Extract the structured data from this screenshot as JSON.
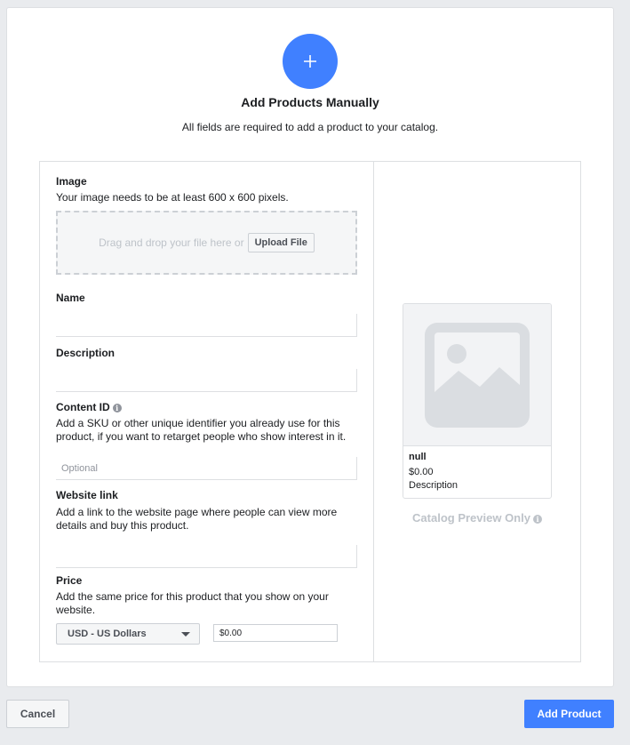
{
  "header": {
    "title": "Add Products Manually",
    "subtitle": "All fields are required to add a product to your catalog.",
    "icon": "plus-icon",
    "accent_color": "#4080ff"
  },
  "form": {
    "image": {
      "label": "Image",
      "help": "Your image needs to be at least 600 x 600 pixels.",
      "dropzone_text": "Drag and drop your file here or",
      "upload_button": "Upload File"
    },
    "name": {
      "label": "Name",
      "value": "",
      "placeholder": ""
    },
    "description": {
      "label": "Description",
      "value": "",
      "placeholder": ""
    },
    "content_id": {
      "label": "Content ID",
      "help": "Add a SKU or other unique identifier you already use for this product, if you want to retarget people who show interest in it.",
      "value": "",
      "placeholder": "Optional",
      "info_icon": "info-icon"
    },
    "website_link": {
      "label": "Website link",
      "help": "Add a link to the website page where people can view more details and buy this product.",
      "value": "",
      "placeholder": ""
    },
    "price": {
      "label": "Price",
      "help": "Add the same price for this product that you show on your website.",
      "currency": "USD - US Dollars",
      "value": "$0.00"
    }
  },
  "preview": {
    "icon": "image-placeholder-icon",
    "name": "null",
    "price": "$0.00",
    "description": "Description",
    "caption": "Catalog Preview Only",
    "info_icon": "info-icon"
  },
  "footer": {
    "cancel_label": "Cancel",
    "add_label": "Add Product"
  }
}
